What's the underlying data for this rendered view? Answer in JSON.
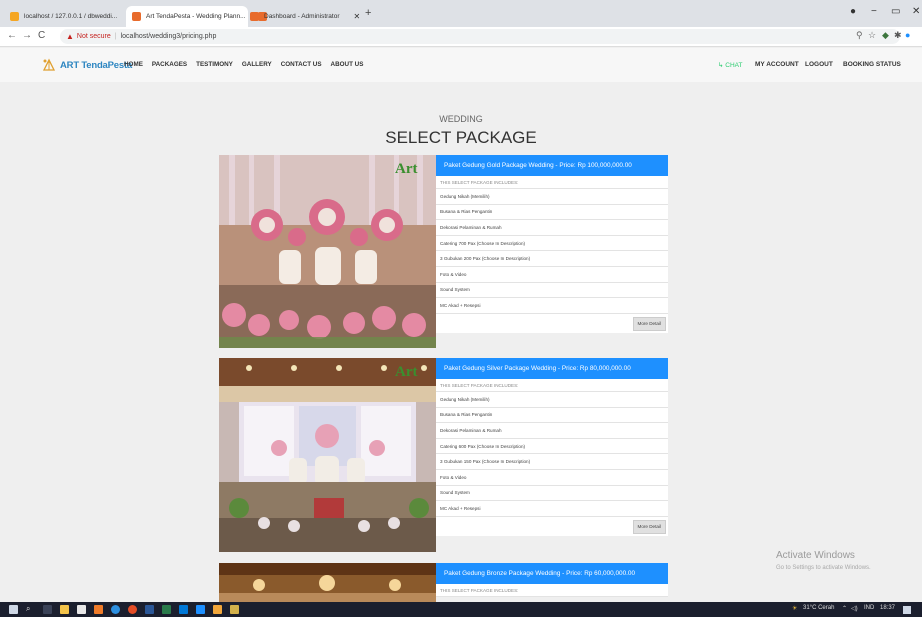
{
  "browser": {
    "tabs": [
      {
        "title": "localhost / 127.0.0.1 / dbweddi...",
        "active": false
      },
      {
        "title": "Art TendaPesta - Wedding Plann...",
        "active": true
      },
      {
        "title": "Dashboard - Administrator",
        "active": false
      }
    ],
    "new_tab": "+",
    "controls": {
      "minimize": "−",
      "maximize": "▭",
      "close": "✕"
    },
    "address": {
      "warning": "Not secure",
      "separator": "|",
      "url": "localhost/wedding3/pricing.php"
    }
  },
  "site": {
    "logo": "ART TendaPesta",
    "menu": [
      "HOME",
      "PACKAGES",
      "TESTIMONY",
      "GALLERY",
      "CONTACT US",
      "ABOUT US"
    ],
    "right_menu": {
      "chat": "CHAT",
      "account": "MY ACCOUNT",
      "logout": "LOGOUT",
      "booking": "BOOKING STATUS"
    }
  },
  "heading": {
    "small": "WEDDING",
    "large": "SELECT PACKAGE"
  },
  "packages": [
    {
      "title": "Paket Gedung Gold Package Wedding - Price: Rp 100,000,000.00",
      "includes_label": "THIS SELECT PACKAGE INCLUDES:",
      "items": [
        "Gedung Nikah (Memilih)",
        "Busana & Rias Pengantin",
        "Dekorasi Pelaminan & Rumah",
        "Catering 700 Pax (Choose In Description)",
        "3 Gubukan 200 Pax (Choose In Description)",
        "Foto & Video",
        "Sound System",
        "MC Akad + Resepsi"
      ],
      "button": "More Detail",
      "theme": "gold"
    },
    {
      "title": "Paket Gedung Silver Package Wedding - Price: Rp 80,000,000.00",
      "includes_label": "THIS SELECT PACKAGE INCLUDES:",
      "items": [
        "Gedung Nikah (Memilih)",
        "Busana & Rias Pengantin",
        "Dekorasi Pelaminan & Rumah",
        "Catering 600 Pax (Choose In Description)",
        "3 Gubukan 150 Pax (Choose In Description)",
        "Foto & Video",
        "Sound System",
        "MC Akad + Resepsi"
      ],
      "button": "More Detail",
      "theme": "silver"
    },
    {
      "title": "Paket Gedung Bronze Package Wedding - Price: Rp 60,000,000.00",
      "includes_label": "THIS SELECT PACKAGE INCLUDES:",
      "items": [],
      "button": "",
      "theme": "bronze"
    }
  ],
  "image_logo": "Art",
  "watermark": {
    "line1": "Activate Windows",
    "line2": "Go to Settings to activate Windows."
  },
  "taskbar": {
    "weather": "31°C Cerah",
    "lang": "IND",
    "time": "18:37"
  },
  "colors": {
    "accent": "#1e90ff",
    "chat": "#2ecc71",
    "logo": "#2e86c1"
  }
}
